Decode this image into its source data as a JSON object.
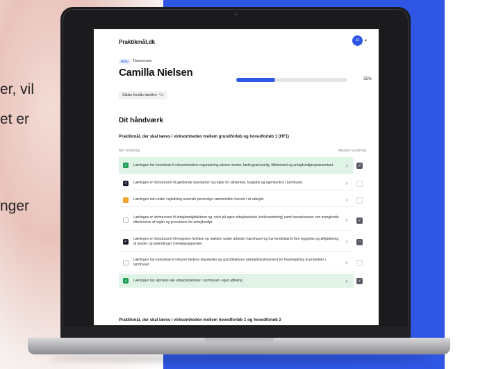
{
  "left_text": {
    "line1": "er, vil",
    "line2": "et er",
    "line3": "nger"
  },
  "app": {
    "logo": "Praktikmål.dk",
    "avatar_initials": "JJ",
    "avatar_caret": "▾"
  },
  "profile": {
    "status_badge": "Aktiv",
    "role": "Tarmrenser",
    "name": "Camilla Nielsen",
    "progress_label": "35%",
    "progress_fraction": 0.35,
    "how_to_read": "Sådan forstås tabellen",
    "how_to_read_toggle": "Vis"
  },
  "section": {
    "title": "Dit håndværk",
    "subtitle": "Praktikmål, der skal læres i virksomheden mellem grundforløb og hovedforløb 1 (HF1)",
    "col_left": "Min vurdering",
    "col_right": "Mesters vurdering"
  },
  "rows": [
    {
      "text": "Lærlingen har kendskab til virksomhedens organisering såsom mester, lærlingeansvarlig, tillidsmand og arbejdsmiljørepræsentant",
      "status": "green",
      "mark": "✓",
      "green_row": true,
      "mester": "filled",
      "mester_mark": "✓",
      "chevron": "›"
    },
    {
      "text": "Lærlingen er introduceret til gældende standarder og regler for sikkerhed, hygiejne og egenkontrol i tarmhuset.",
      "status": "dark",
      "mark": "✓",
      "green_row": false,
      "mester": "empty",
      "mester_mark": "",
      "chevron": "›"
    },
    {
      "text": "Lærlingen kan under vejledning anvende personlige værnemidler korrekt i sit arbejde",
      "status": "orange",
      "mark": "○",
      "green_row": false,
      "mester": "empty",
      "mester_mark": "",
      "chevron": "›"
    },
    {
      "text": "Lærlingen er introduceret til arbejdsmiljøfaktorer og -risici på egen arbejdsstation (risikovurdering) samt konsekvenser ved manglende efterlevelse af  regler og procedurer for arbejdsmiljø",
      "status": "empty",
      "mark": "",
      "green_row": false,
      "mester": "filled",
      "mester_mark": "✓",
      "chevron": "›"
    },
    {
      "text": "Lærlingen er introduceret til kroppens funktion og reaktion under arbejde i tarmhuset og har kendskab til fore byggelse og afhjælpning af skader og  spændinger i bevægeapparatet",
      "status": "dark",
      "mark": "✓",
      "green_row": false,
      "mester": "filled",
      "mester_mark": "○",
      "chevron": "›"
    },
    {
      "text": "Lærlingen har kendskab til virksom hedens standarder og specifikationer (arbejdsbeskrivelser) for forarbejdning  af produkter i tarmhuset",
      "status": "empty",
      "mark": "",
      "green_row": false,
      "mester": "empty",
      "mester_mark": "",
      "chevron": "›"
    },
    {
      "text": "Lærlingen har afprøvet alle arbejdsstationer i tarmhuset i egen afdeling",
      "status": "green",
      "mark": "✓",
      "green_row": true,
      "mester": "filled",
      "mester_mark": "✓",
      "chevron": "›"
    }
  ],
  "section2": {
    "title": "Praktikmål, der skal læres i virksomheden mellem hovedforløb 1 og hovedforløb 2"
  },
  "colors": {
    "accent": "#2f56e2",
    "green": "#1f9d55",
    "green_row": "#dff4e6",
    "orange": "#f0a020"
  }
}
